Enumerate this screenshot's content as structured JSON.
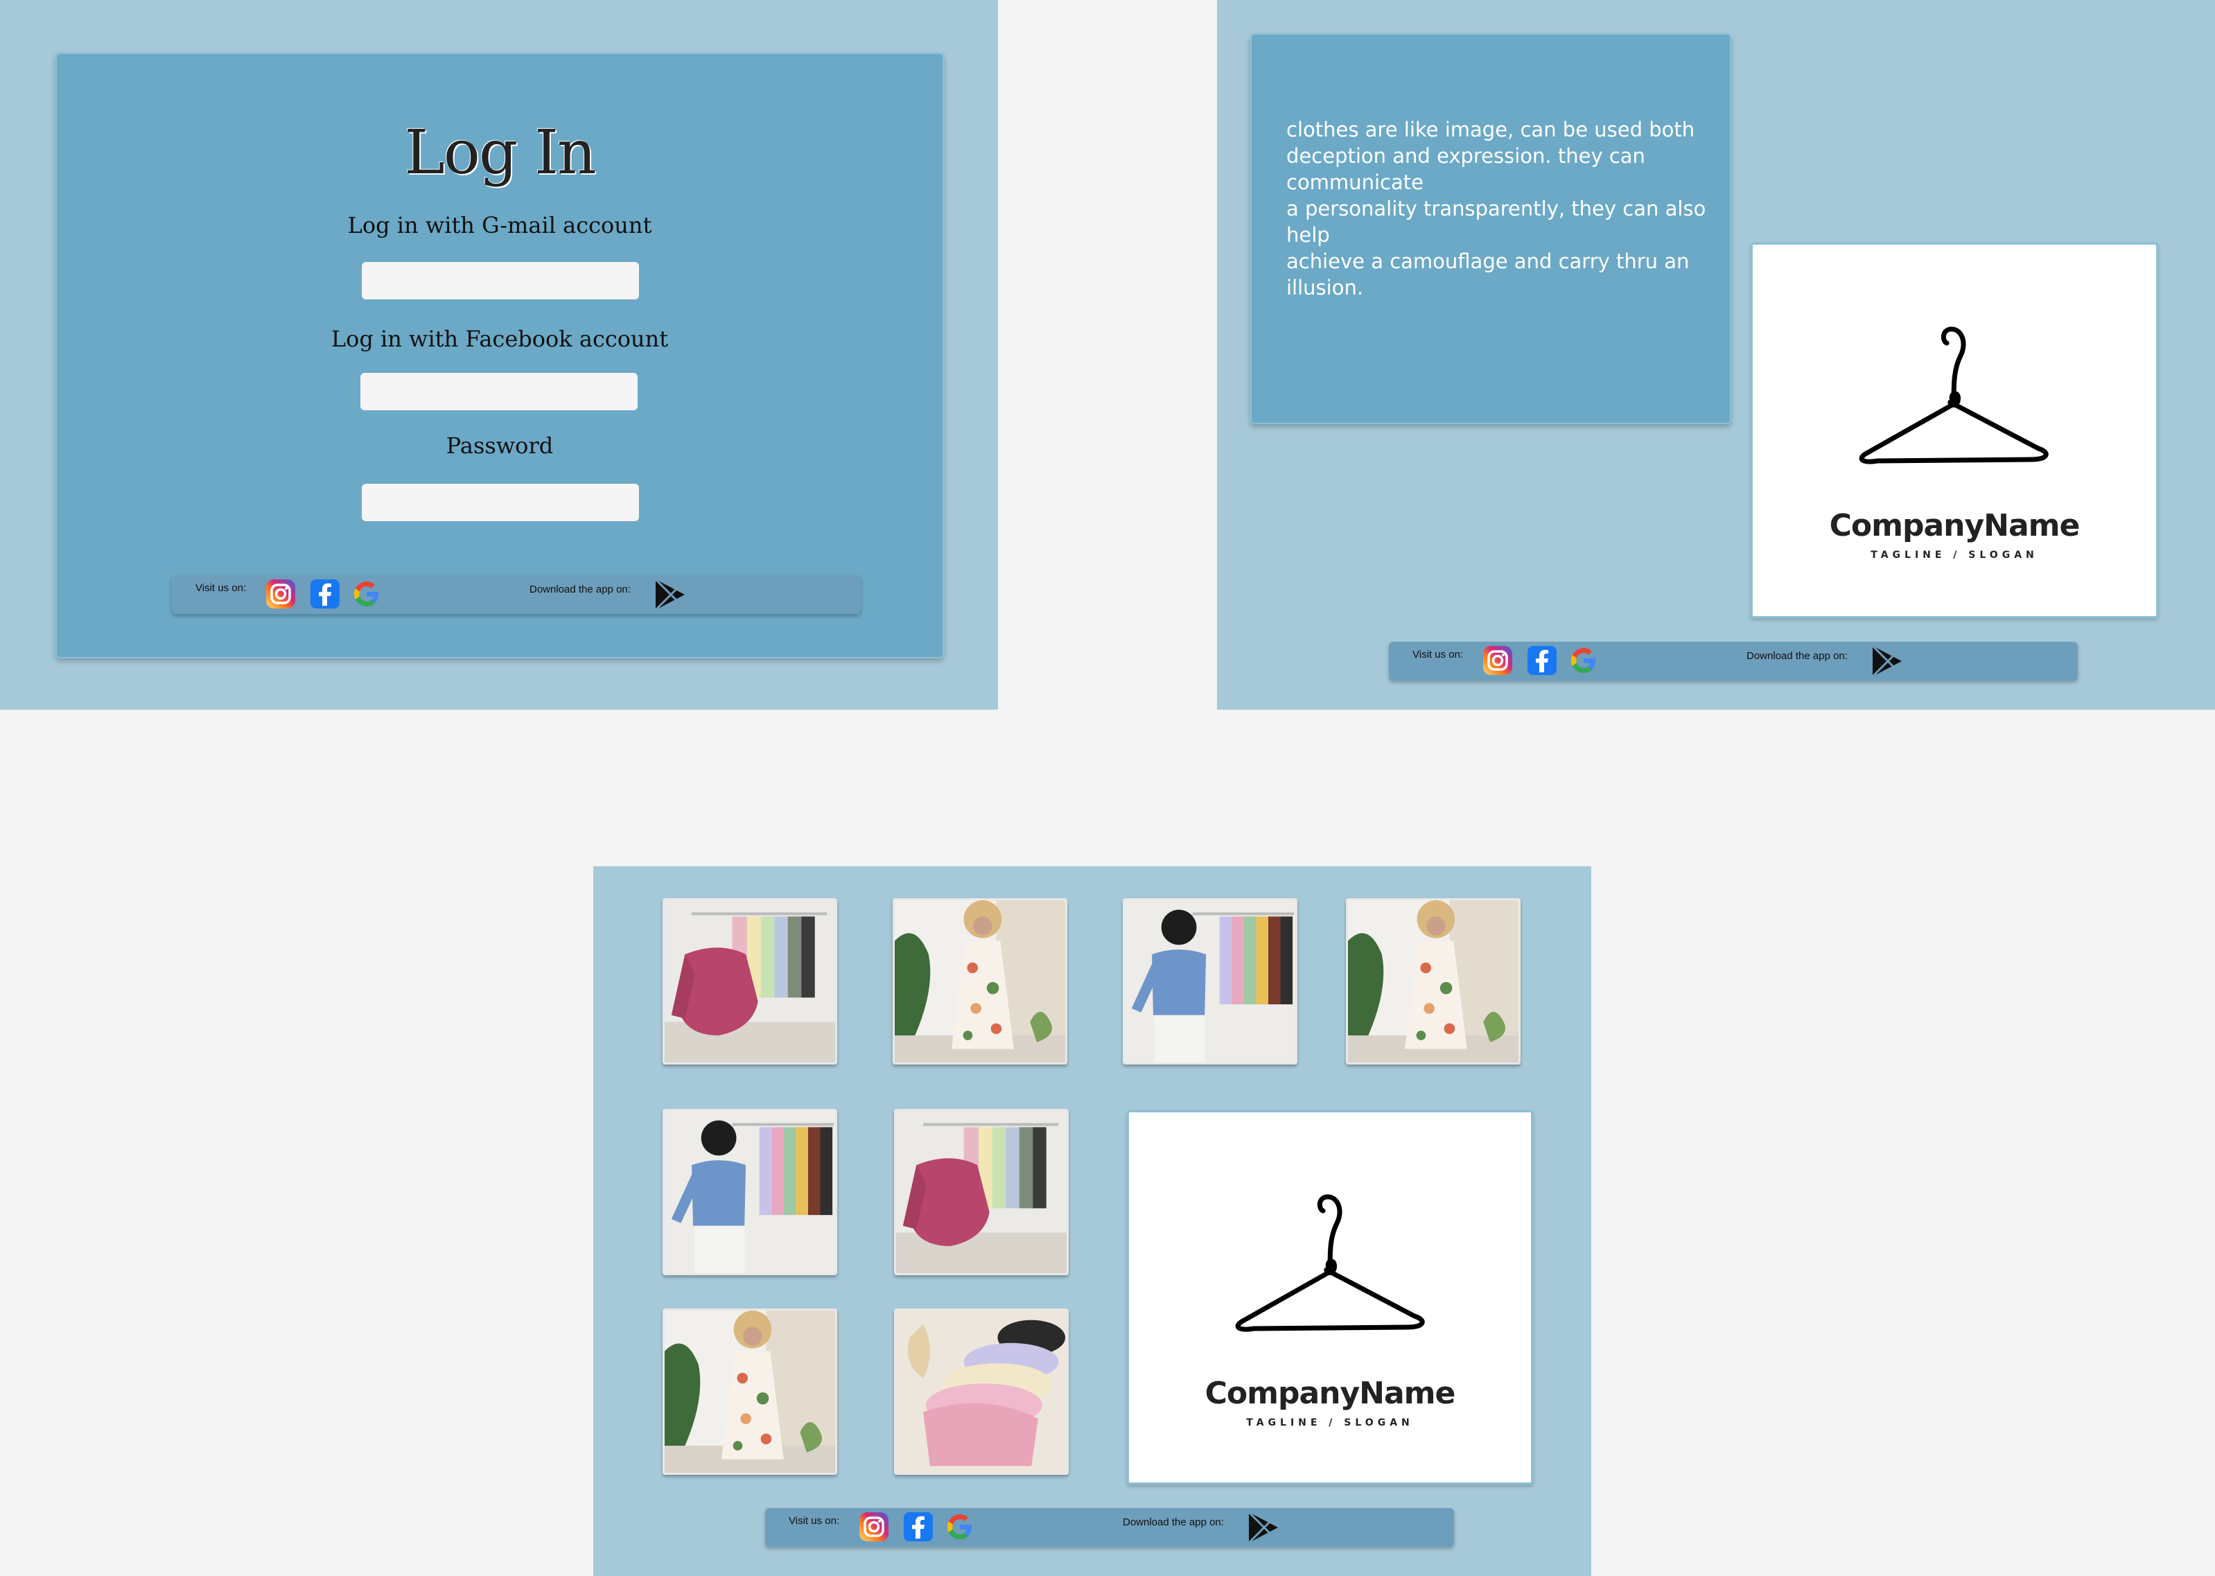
{
  "login": {
    "title": "Log In",
    "gmail_label": "Log in with G-mail account",
    "facebook_label": "Log in with Facebook account",
    "password_label": "Password",
    "gmail_value": "",
    "facebook_value": "",
    "password_value": ""
  },
  "about": {
    "text": "clothes are like image, can be used both\ndeception and expression. they can\ncommunicate\n a personality transparently, they can also\nhelp\nachieve a camouflage and carry thru an\nillusion."
  },
  "logo": {
    "name": "CompanyName",
    "tagline": "TAGLINE / SLOGAN"
  },
  "footer": {
    "visit_label": "Visit us on:",
    "download_label": "Download the app on:",
    "social_icons": [
      "instagram-icon",
      "facebook-icon",
      "google-icon"
    ],
    "store_icon": "play-store-icon"
  },
  "gallery": {
    "photos": [
      "sweater-rack-photo",
      "floral-dress-photo",
      "blue-top-photo",
      "floral-dress-photo",
      "blue-top-photo",
      "sweater-rack-photo",
      "floral-dress-photo",
      "folded-sweaters-photo"
    ]
  },
  "colors": {
    "frame_bg": "#a6c9d9",
    "panel_bg": "#6ba9c6",
    "footer_bg": "#6d9ebc",
    "page_bg": "#f4f4f4"
  }
}
